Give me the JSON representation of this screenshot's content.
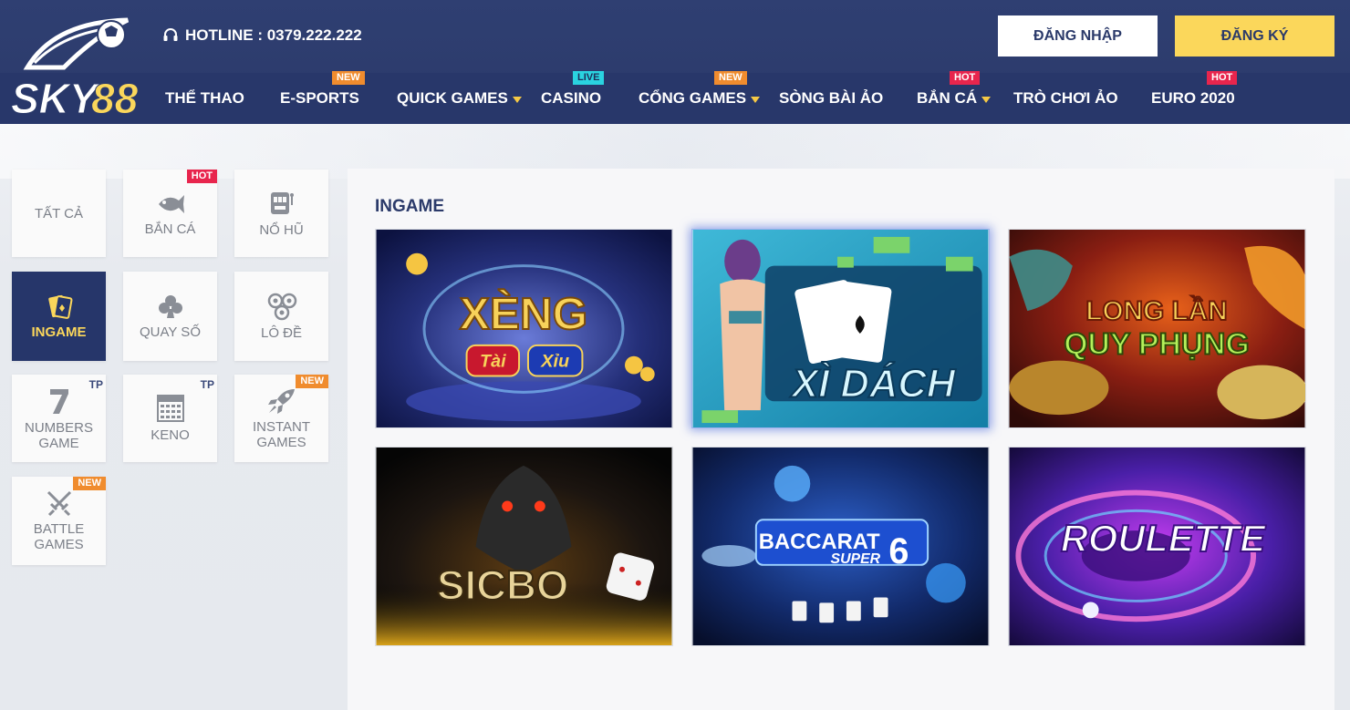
{
  "header": {
    "brand": "SKY88",
    "hotline": "HOTLINE : 0379.222.222",
    "login_label": "ĐĂNG NHẬP",
    "register_label": "ĐĂNG KÝ",
    "colors": {
      "header_bg": "#2b3a6a",
      "accent_yellow": "#fbd75b",
      "badge_new": "#f08c2e",
      "badge_hot": "#e8254d",
      "badge_live": "#2ad3e0"
    }
  },
  "nav": [
    {
      "label": "THỂ THAO"
    },
    {
      "label": "E-SPORTS",
      "badge": "NEW"
    },
    {
      "label": "QUICK GAMES",
      "has_dropdown": true
    },
    {
      "label": "CASINO",
      "badge": "LIVE"
    },
    {
      "label": "CỔNG GAMES",
      "badge": "NEW",
      "has_dropdown": true
    },
    {
      "label": "SÒNG BÀI ẢO"
    },
    {
      "label": "BẮN CÁ",
      "badge": "HOT",
      "has_dropdown": true
    },
    {
      "label": "TRÒ CHƠI ẢO"
    },
    {
      "label": "EURO 2020",
      "badge": "HOT"
    }
  ],
  "categories": [
    {
      "label": "TẤT CẢ",
      "icon": "all"
    },
    {
      "label": "BẮN CÁ",
      "icon": "fish-icon",
      "badge": "HOT"
    },
    {
      "label": "NỔ HŨ",
      "icon": "slot-machine-icon"
    },
    {
      "label": "INGAME",
      "icon": "cards-icon",
      "active": true
    },
    {
      "label": "QUAY SỐ",
      "icon": "club-icon"
    },
    {
      "label": "LÔ ĐỀ",
      "icon": "lottery-balls-icon"
    },
    {
      "label": "NUMBERS GAME",
      "icon": "seven-icon",
      "tag": "TP"
    },
    {
      "label": "KENO",
      "icon": "keno-icon",
      "tag": "TP"
    },
    {
      "label": "INSTANT GAMES",
      "icon": "rocket-icon",
      "badge": "NEW"
    },
    {
      "label": "BATTLE GAMES",
      "icon": "swords-icon",
      "badge": "NEW"
    }
  ],
  "section": {
    "title": "INGAME",
    "games": [
      {
        "title": "XÈNG",
        "subtitle_left": "Tài",
        "subtitle_right": "Xỉu"
      },
      {
        "title": "XÌ DÁCH"
      },
      {
        "title": "LONG LẦN",
        "subtitle": "QUY PHỤNG"
      },
      {
        "title": "SICBO"
      },
      {
        "title": "BACCARAT",
        "subtitle": "SUPER",
        "number": "6"
      },
      {
        "title": "ROULETTE"
      }
    ]
  }
}
